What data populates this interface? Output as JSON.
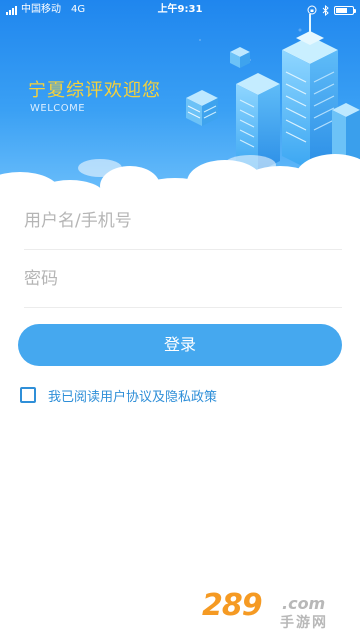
{
  "status_bar": {
    "carrier": "中国移动",
    "network": "4G",
    "time": "上午9:31",
    "icons": [
      "signal-icon",
      "lock-rotation-icon",
      "bluetooth-icon",
      "battery-icon"
    ],
    "battery_level": 0.7
  },
  "header": {
    "title": "宁夏综评欢迎您",
    "subtitle": "WELCOME"
  },
  "form": {
    "username_placeholder": "用户名/手机号",
    "username_value": "",
    "password_placeholder": "密码",
    "password_value": "",
    "login_label": "登录",
    "agree_checked": false,
    "agree_text": "我已阅读用户协议及隐私政策"
  },
  "watermark": {
    "number": "289",
    "domain": ".com",
    "chinese": "手游网"
  },
  "colors": {
    "header_blue": "#2a8ef0",
    "title_gold": "#f7d23a",
    "button_blue": "#45a8ef",
    "link_blue": "#2f8fd8",
    "watermark_orange": "#f59a23"
  }
}
